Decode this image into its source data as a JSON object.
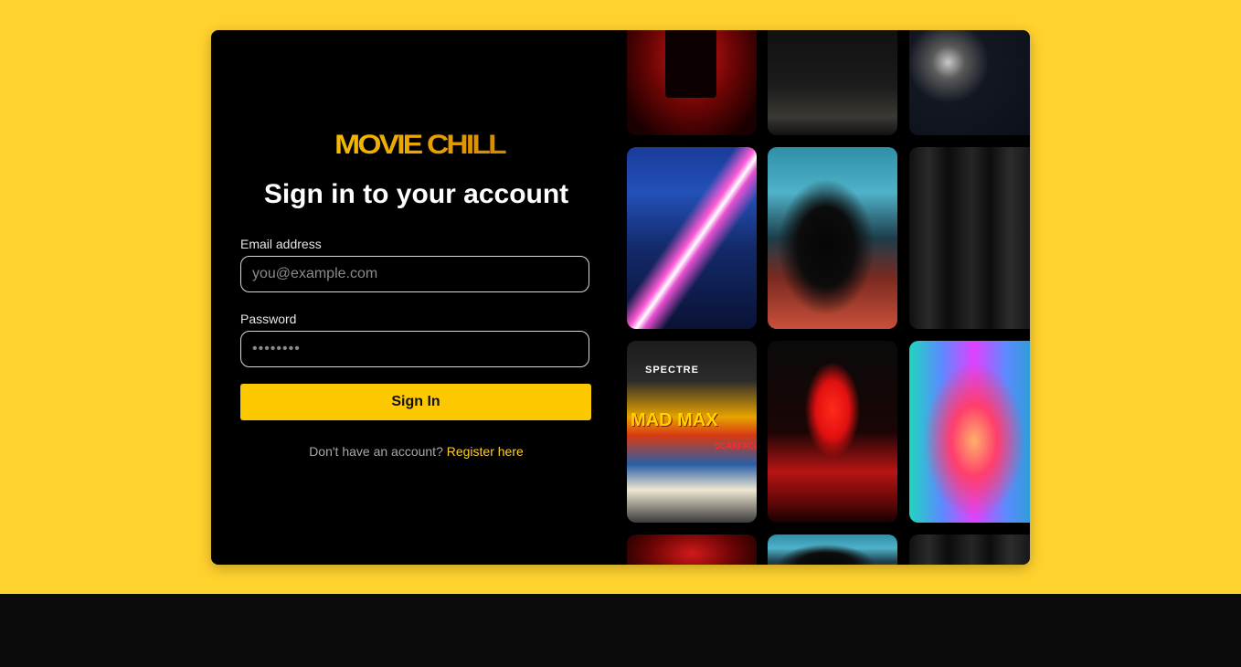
{
  "brand": {
    "logo_text": "MOVIE CHILL"
  },
  "form": {
    "title": "Sign in to your account",
    "email_label": "Email address",
    "email_placeholder": "you@example.com",
    "password_label": "Password",
    "password_placeholder": "••••••••",
    "submit_label": "Sign In",
    "register_prompt": "Don't have an account?",
    "register_link": "Register here"
  },
  "gallery": {
    "posters": {
      "spectre": "SPECTRE",
      "mad_max": "MAD MAX",
      "scarface": "SCARFACE"
    }
  },
  "colors": {
    "background": "#ffd22e",
    "accent": "#fcc800",
    "card": "#000000",
    "footer": "#0b0b0b",
    "link": "#ffcf2e"
  }
}
